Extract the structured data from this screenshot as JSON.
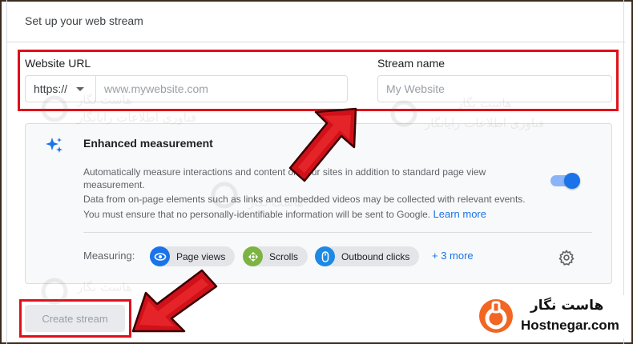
{
  "header": {
    "title": "Set up your web stream"
  },
  "form": {
    "website_url_label": "Website URL",
    "protocol_value": "https://",
    "url_placeholder": "www.mywebsite.com",
    "url_value": "",
    "stream_name_label": "Stream name",
    "stream_name_placeholder": "My Website",
    "stream_name_value": ""
  },
  "enhanced_measurement": {
    "title": "Enhanced measurement",
    "description_line1": "Automatically measure interactions and content on your sites in addition to standard page view",
    "description_line2": "measurement.",
    "description_line3": "Data from on-page elements such as links and embedded videos may be collected with relevant events.",
    "description_line4": "You must ensure that no personally-identifiable information will be sent to Google.",
    "learn_more": "Learn more",
    "toggle_on": true,
    "measuring_label": "Measuring:",
    "chips": [
      {
        "label": "Page views",
        "icon": "eye-icon",
        "color": "#1a73e8"
      },
      {
        "label": "Scrolls",
        "icon": "scroll-icon",
        "color": "#7cb342"
      },
      {
        "label": "Outbound clicks",
        "icon": "mouse-icon",
        "color": "#1e88e5"
      }
    ],
    "more_link": "+ 3 more"
  },
  "actions": {
    "create_stream": "Create stream"
  },
  "watermark": {
    "brand_fa": "هاست نگار",
    "brand_en": "Hostnegar.com",
    "tagline_fa": "فناوری اطلاعات رایانگار"
  },
  "colors": {
    "annotation_red": "#e0101a",
    "accent_blue": "#1a73e8"
  }
}
